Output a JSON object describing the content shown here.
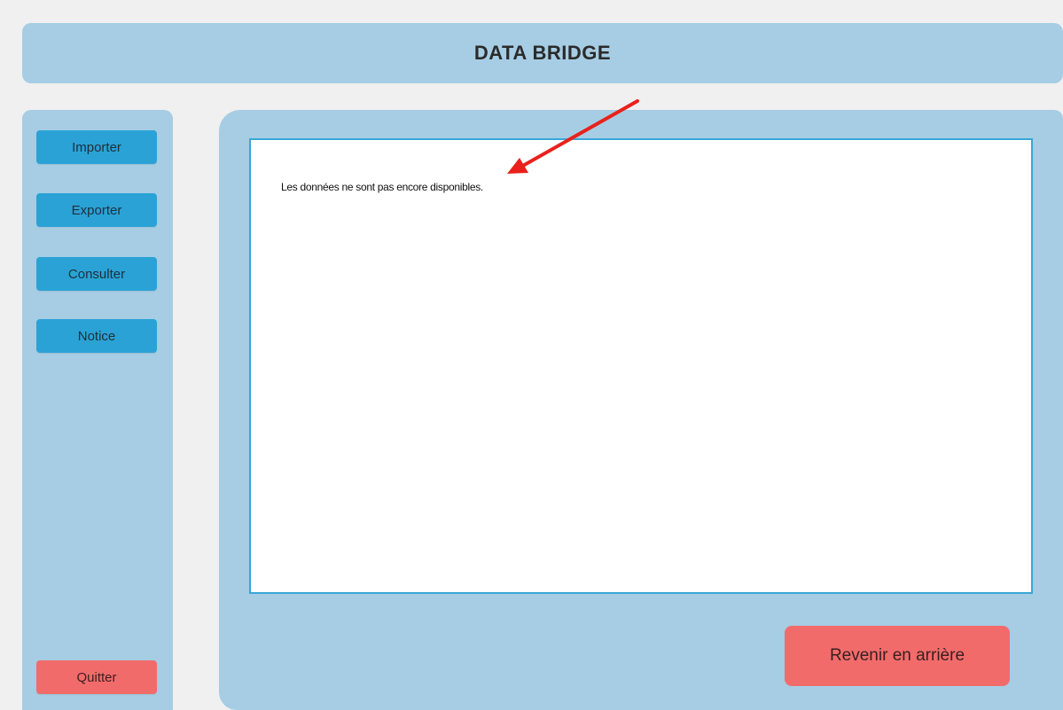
{
  "header": {
    "title": "DATA BRIDGE"
  },
  "sidebar": {
    "items": [
      {
        "label": "Importer"
      },
      {
        "label": "Exporter"
      },
      {
        "label": "Consulter"
      },
      {
        "label": "Notice"
      }
    ],
    "quit_label": "Quitter"
  },
  "main": {
    "message": "Les données ne sont pas encore disponibles.",
    "back_label": "Revenir en arrière"
  },
  "colors": {
    "panel": "#a6cde4",
    "primary_button": "#2aa2d6",
    "danger_button": "#f26b6b",
    "annotation_arrow": "#e8221b"
  }
}
